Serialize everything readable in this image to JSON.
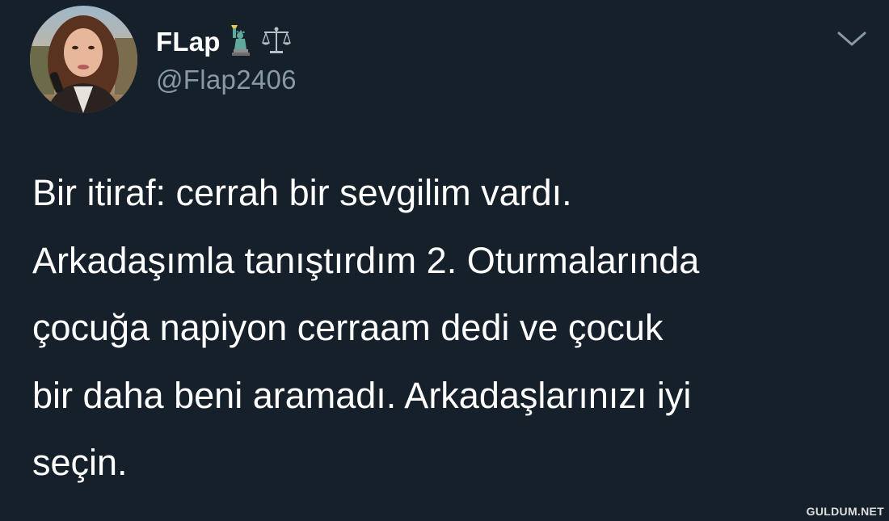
{
  "author": {
    "display_name": "FLap",
    "handle": "@Flap2406",
    "name_emojis": [
      "statue-of-liberty-icon",
      "scales-icon"
    ]
  },
  "tweet": {
    "lines": [
      "Bir itiraf: cerrah bir sevgilim vardı.",
      "Arkadaşımla tanıştırdım 2. Oturmalarında",
      "çocuğa napiyon cerraam dedi ve çocuk",
      "bir daha beni aramadı. Arkadaşlarınızı iyi",
      "seçin."
    ]
  },
  "watermark": "GULDUM.NET",
  "colors": {
    "background": "#15202b",
    "text": "#ffffff",
    "secondary_text": "#8899a6",
    "statue_green": "#5fa89a"
  }
}
